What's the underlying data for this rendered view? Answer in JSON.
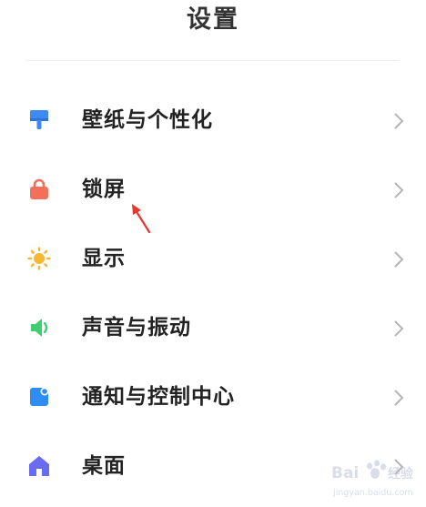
{
  "header": {
    "title": "设置"
  },
  "settings": {
    "items": [
      {
        "label": "壁纸与个性化",
        "icon": "paint-brush-icon",
        "color": "#3d8bf2"
      },
      {
        "label": "锁屏",
        "icon": "lock-icon",
        "color": "#f26f5c"
      },
      {
        "label": "显示",
        "icon": "sun-icon",
        "color": "#f7b731"
      },
      {
        "label": "声音与振动",
        "icon": "speaker-icon",
        "color": "#3ecf72"
      },
      {
        "label": "通知与控制中心",
        "icon": "notification-icon",
        "color": "#2f8cf0"
      },
      {
        "label": "桌面",
        "icon": "home-icon",
        "color": "#6a6cf0"
      }
    ]
  },
  "annotation": {
    "color": "#e8362c"
  },
  "watermark": {
    "brand": "Baidu经验",
    "url": "jingyan.baidu.com"
  }
}
